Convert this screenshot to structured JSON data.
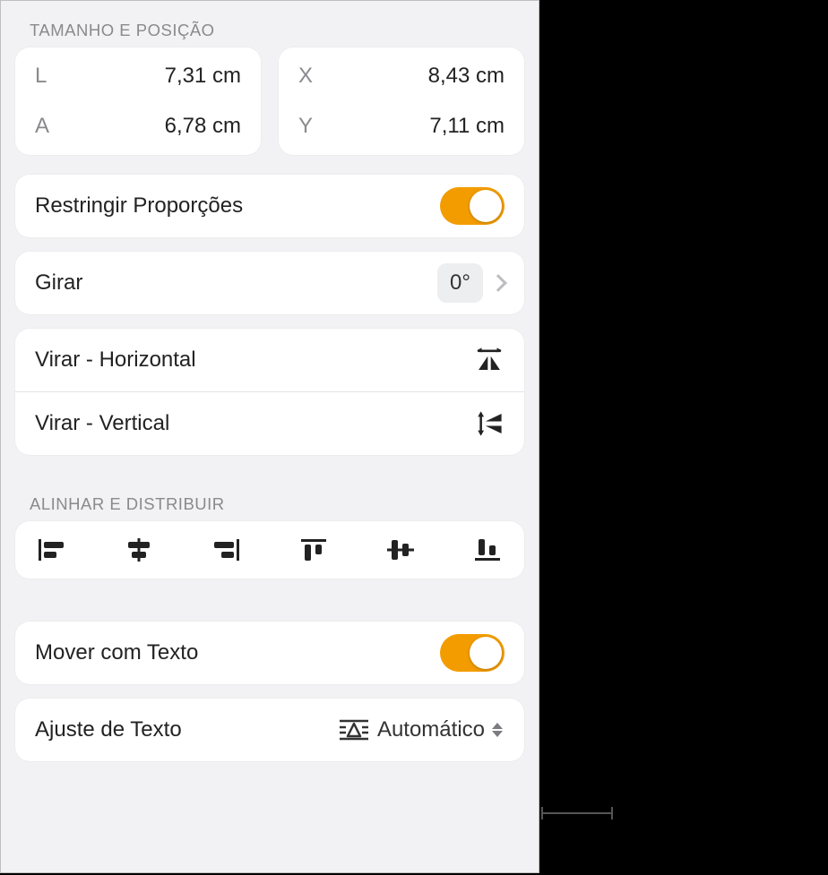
{
  "sizePos": {
    "header": "TAMANHO E POSIÇÃO",
    "width": {
      "label": "L",
      "value": "7,31 cm"
    },
    "height": {
      "label": "A",
      "value": "6,78 cm"
    },
    "x": {
      "label": "X",
      "value": "8,43 cm"
    },
    "y": {
      "label": "Y",
      "value": "7,11 cm"
    }
  },
  "constrain": {
    "label": "Restringir Proporções",
    "on": true
  },
  "rotate": {
    "label": "Girar",
    "value": "0°"
  },
  "flip": {
    "horizontal": "Virar - Horizontal",
    "vertical": "Virar - Vertical"
  },
  "alignHeader": "ALINHAR E DISTRIBUIR",
  "moveWithText": {
    "label": "Mover com Texto",
    "on": true
  },
  "textWrap": {
    "label": "Ajuste de Texto",
    "value": "Automático"
  },
  "colors": {
    "accent": "#f39c00"
  }
}
